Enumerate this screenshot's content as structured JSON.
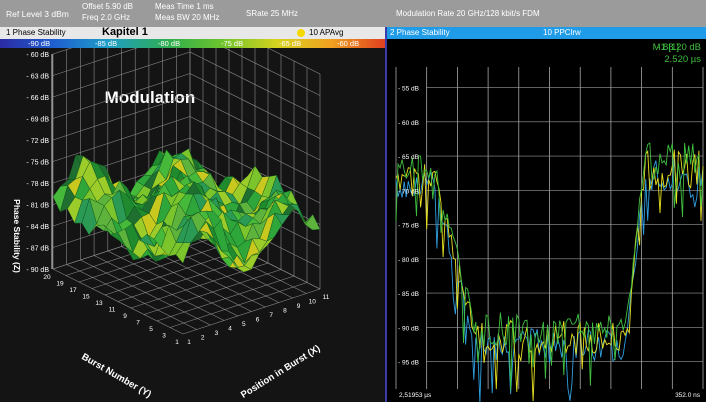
{
  "header": {
    "ref_level": "Ref Level 3 dBm",
    "offset": "Offset 5.90 dB",
    "freq": "Freq   2.0 GHz",
    "meas_time": "Meas Time     1 ms",
    "meas_bw": "Meas BW   20 MHz",
    "srate": "SRate 25 MHz",
    "modulation_rate": "Modulation Rate 20  GHz/128 kbit/s  FDM"
  },
  "window1": {
    "title": "1 Phase Stability",
    "chapter": "Kapitel 1",
    "avg_label": "10 APAvg",
    "avg_dot_color": "#f5d800",
    "colorbar_labels": [
      "-90 dB",
      "-85 dB",
      "-80 dB",
      "-75 dB",
      "-65 dB",
      "-60 dB"
    ],
    "plot_title": "Modulation",
    "z_axis_title": "Phase Stability (Z)",
    "z_ticks": [
      "- 60 dB",
      "- 63 dB",
      "- 66 dB",
      "- 69 dB",
      "- 72 dB",
      "- 75 dB",
      "- 78 dB",
      "- 81 dB",
      "- 84 dB",
      "- 87 dB",
      "- 90 dB"
    ],
    "y_axis_title": "Burst Number (Y)",
    "y_ticks": [
      "20",
      "19",
      "17",
      "15",
      "13",
      "11",
      "9",
      "7",
      "5",
      "3",
      "1"
    ],
    "x_axis_title": "Position in Burst (X)",
    "x_ticks": [
      "1",
      "2",
      "3",
      "4",
      "5",
      "6",
      "7",
      "8",
      "9",
      "10",
      "11"
    ]
  },
  "window2": {
    "title": "2 Phase Stability",
    "trace_mode": "10 PPClrw",
    "marker_label": "M1 [1]",
    "marker_value": "- 88.20 dB",
    "marker_time": "2.520 µs",
    "marker_color": "#3fbf3f",
    "y_ticks": [
      "- 55 dB",
      "- 60 dB",
      "- 65 dB",
      "- 70 dB",
      "- 75 dB",
      "- 80 dB",
      "- 85 dB",
      "- 90 dB",
      "- 95 dB"
    ],
    "x_start": "2,51953 µs",
    "x_end": "352.0 ns",
    "trace_colors": [
      "#2f9fe0",
      "#e8e020",
      "#3fbf3f"
    ]
  }
}
